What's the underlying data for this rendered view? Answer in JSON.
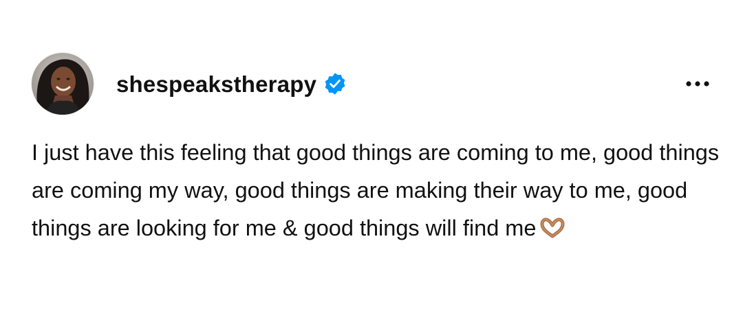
{
  "post": {
    "username": "shespeakstherapy",
    "verified": true,
    "verified_icon": "verified-badge-icon",
    "more_icon": "more-options-icon",
    "emoji_icon": "heart-hands-emoji",
    "accent_color": "#0095f6",
    "text": "I just have this feeling that good things are coming to me, good things are coming my way, good things are making their way to me, good things are looking for me & good things will find me"
  }
}
